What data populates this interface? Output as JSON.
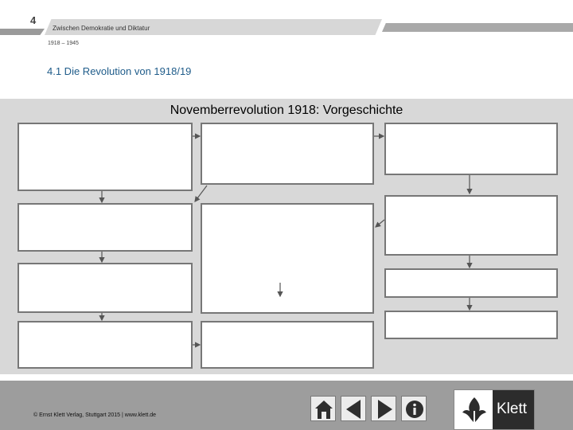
{
  "header": {
    "slide_number": "4",
    "title": "Zwischen Demokratie und Diktatur",
    "period": "1918 – 1945",
    "section": "4.1  Die Revolution von 1918/19"
  },
  "diagram": {
    "title": "Novemberrevolution 1918: Vorgeschichte",
    "boxes": [
      "",
      "",
      "",
      "",
      "",
      "",
      "",
      "",
      "",
      "",
      ""
    ]
  },
  "footer": {
    "copyright": "© Ernst Klett Verlag, Stuttgart 2015 | www.klett.de",
    "logo_text": "Klett"
  },
  "icons": {
    "home": "home-icon",
    "prev": "previous-arrow-icon",
    "next": "next-arrow-icon",
    "info": "info-icon",
    "logo": "klett-logo-icon"
  },
  "colors": {
    "heading": "#1f5c8a",
    "diagram_bg": "#d8d8d8",
    "footer_bg": "#9d9d9d",
    "nav_icon": "#2e2e2e"
  }
}
